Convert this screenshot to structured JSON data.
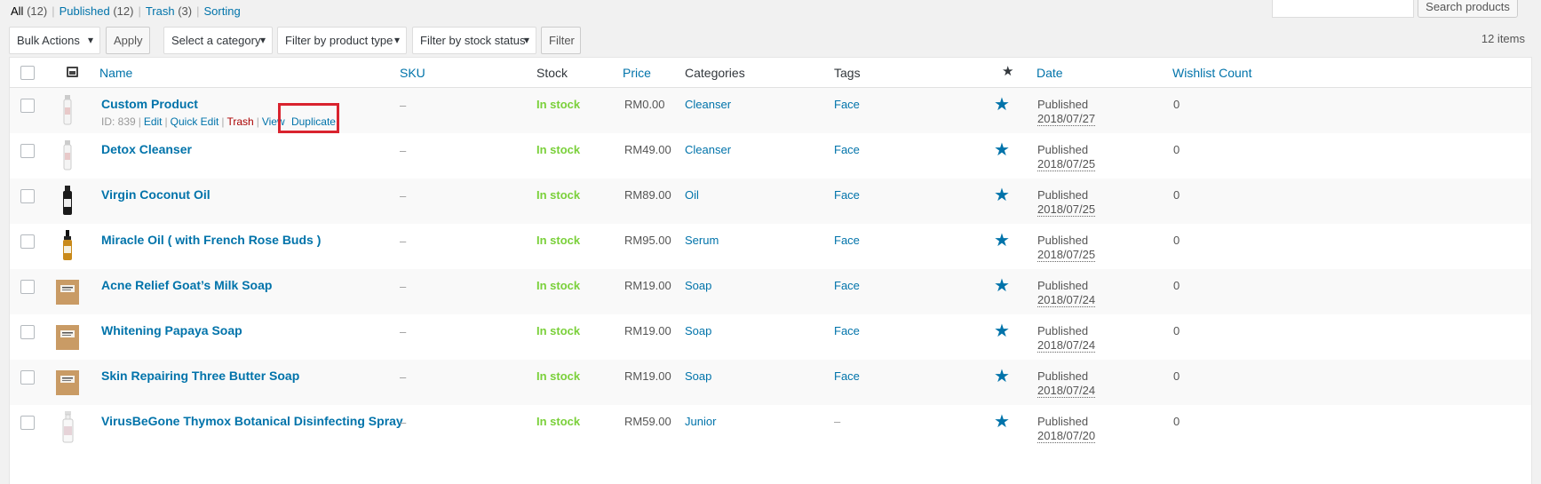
{
  "views": {
    "all": {
      "label": "All",
      "count": "(12)"
    },
    "published": {
      "label": "Published",
      "count": "(12)"
    },
    "trash": {
      "label": "Trash",
      "count": "(3)"
    },
    "sorting": {
      "label": "Sorting"
    },
    "separator": "|"
  },
  "search": {
    "button_label": "Search products",
    "value": ""
  },
  "tablenav": {
    "bulk_actions": "Bulk Actions",
    "apply": "Apply",
    "category": "Select a category",
    "product_type": "Filter by product type",
    "stock_status": "Filter by stock status",
    "filter": "Filter",
    "items_count": "12 items"
  },
  "columns": {
    "name": "Name",
    "sku": "SKU",
    "stock": "Stock",
    "price": "Price",
    "categories": "Categories",
    "tags": "Tags",
    "featured_icon": "star-icon",
    "date": "Date",
    "wishlist": "Wishlist Count"
  },
  "row_actions": {
    "id": "ID: 839",
    "edit": "Edit",
    "quick_edit": "Quick Edit",
    "trash": "Trash",
    "view": "View",
    "duplicate": "Duplicate",
    "separator": "|"
  },
  "highlight_color": "#d9232e",
  "products": [
    {
      "name": "Custom Product",
      "sku": "–",
      "stock": "In stock",
      "price": "RM0.00",
      "category": "Cleanser",
      "tag": "Face",
      "status": "Published",
      "date": "2018/07/27",
      "wishlist": "0",
      "thumb": "white-bottle"
    },
    {
      "name": "Detox Cleanser",
      "sku": "–",
      "stock": "In stock",
      "price": "RM49.00",
      "category": "Cleanser",
      "tag": "Face",
      "status": "Published",
      "date": "2018/07/25",
      "wishlist": "0",
      "thumb": "white-bottle"
    },
    {
      "name": "Virgin Coconut Oil",
      "sku": "–",
      "stock": "In stock",
      "price": "RM89.00",
      "category": "Oil",
      "tag": "Face",
      "status": "Published",
      "date": "2018/07/25",
      "wishlist": "0",
      "thumb": "black-bottle"
    },
    {
      "name": "Miracle Oil ( with French Rose Buds )",
      "sku": "–",
      "stock": "In stock",
      "price": "RM95.00",
      "category": "Serum",
      "tag": "Face",
      "status": "Published",
      "date": "2018/07/25",
      "wishlist": "0",
      "thumb": "amber-dropper"
    },
    {
      "name": "Acne Relief Goat’s Milk Soap",
      "sku": "–",
      "stock": "In stock",
      "price": "RM19.00",
      "category": "Soap",
      "tag": "Face",
      "status": "Published",
      "date": "2018/07/24",
      "wishlist": "0",
      "thumb": "soap-box"
    },
    {
      "name": "Whitening Papaya Soap",
      "sku": "–",
      "stock": "In stock",
      "price": "RM19.00",
      "category": "Soap",
      "tag": "Face",
      "status": "Published",
      "date": "2018/07/24",
      "wishlist": "0",
      "thumb": "soap-box"
    },
    {
      "name": "Skin Repairing Three Butter Soap",
      "sku": "–",
      "stock": "In stock",
      "price": "RM19.00",
      "category": "Soap",
      "tag": "Face",
      "status": "Published",
      "date": "2018/07/24",
      "wishlist": "0",
      "thumb": "soap-box"
    },
    {
      "name": "VirusBeGone Thymox Botanical Disinfecting Spray",
      "sku": "–",
      "stock": "In stock",
      "price": "RM59.00",
      "category": "Junior",
      "tag": "–",
      "status": "Published",
      "date": "2018/07/20",
      "wishlist": "0",
      "thumb": "spray-bottle"
    }
  ]
}
